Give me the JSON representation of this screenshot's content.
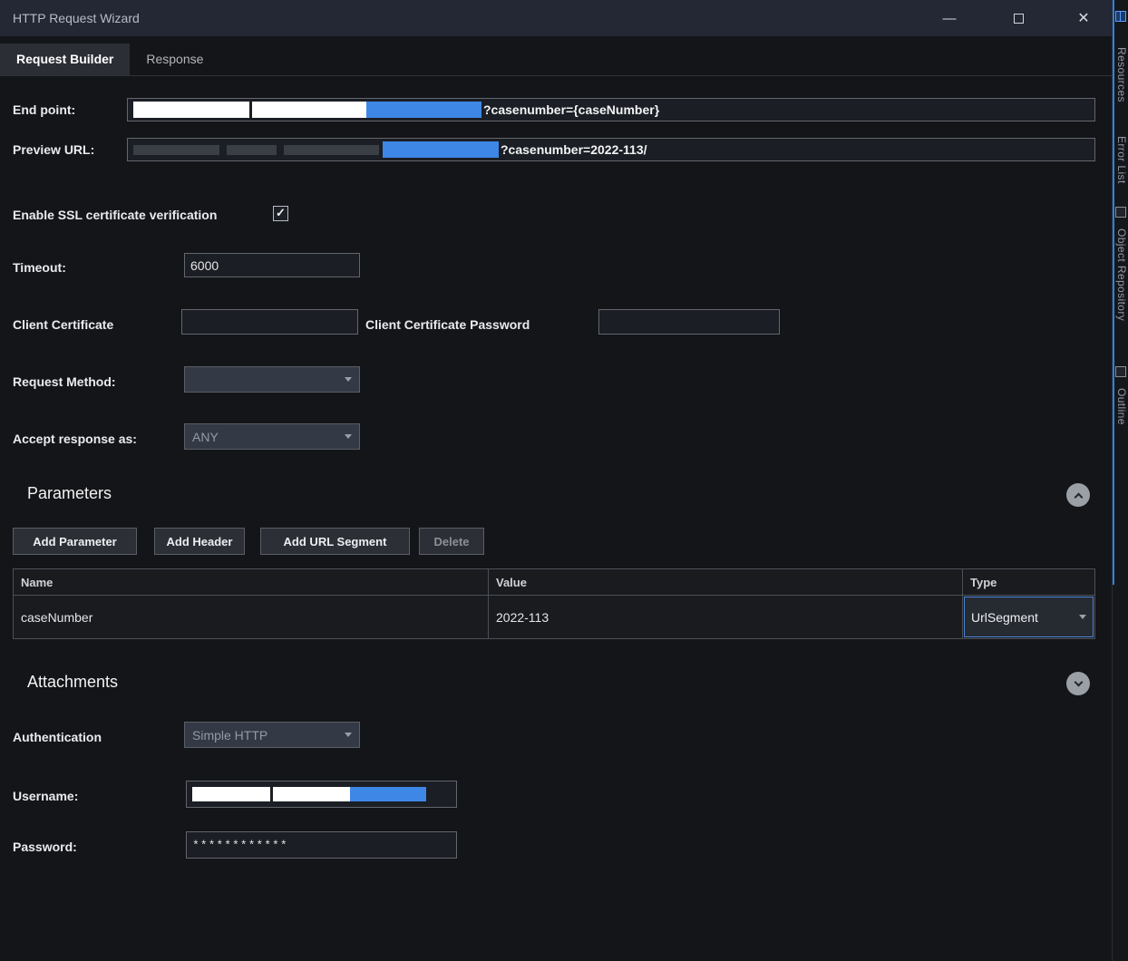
{
  "window": {
    "title": "HTTP Request Wizard"
  },
  "icons": {
    "minimize": "—",
    "close": "✕",
    "check": "✓"
  },
  "colors": {
    "redaction_white": "#ffffff",
    "redaction_blue": "#3e87e6",
    "selected_border_blue": "#4f86d8",
    "dock_indicator_blue": "#2f80e0",
    "titlebar": "#232834",
    "background": "#141519"
  },
  "tabs": {
    "request_builder": "Request Builder",
    "response": "Response"
  },
  "fields": {
    "endpoint_label": "End point:",
    "endpoint_suffix": "?casenumber={caseNumber}",
    "preview_label": "Preview URL:",
    "preview_suffix": "?casenumber=2022-113/",
    "ssl_label": "Enable SSL certificate verification",
    "timeout_label": "Timeout:",
    "timeout_value": "6000",
    "client_cert_label": "Client Certificate",
    "client_cert_value": "",
    "client_cert_password_label": "Client Certificate Password",
    "client_cert_password_value": "",
    "request_method_label": "Request Method:",
    "request_method_value": "",
    "accept_label": "Accept response as:",
    "accept_value": "ANY",
    "auth_label": "Authentication",
    "auth_value": "Simple HTTP",
    "username_label": "Username:",
    "password_label": "Password:",
    "password_value": "************"
  },
  "parameters": {
    "title": "Parameters",
    "add_parameter": "Add Parameter",
    "add_header": "Add Header",
    "add_url_segment": "Add URL Segment",
    "delete": "Delete",
    "headers": {
      "name": "Name",
      "value": "Value",
      "type": "Type"
    },
    "row": {
      "name": "caseNumber",
      "value": "2022-113",
      "type": "UrlSegment"
    }
  },
  "attachments": {
    "title": "Attachments"
  },
  "side_panel": {
    "resources": "Resources",
    "error_list": "Error List",
    "object_repository": "Object Repository",
    "outline": "Outline"
  }
}
